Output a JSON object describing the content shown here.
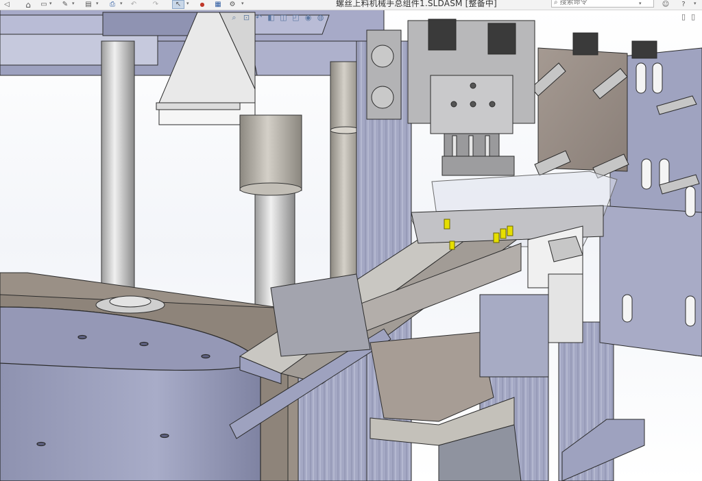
{
  "window": {
    "title": "螺丝上料机械手总组件1.SLDASM [整备中]"
  },
  "search": {
    "placeholder": "搜索命令"
  },
  "toolbar": {
    "items": [
      {
        "name": "solidworks-logo-icon",
        "glyph": "◁"
      },
      {
        "name": "home-icon",
        "glyph": "⌂"
      },
      {
        "name": "new-document-icon",
        "glyph": "▭"
      },
      {
        "name": "open-document-icon",
        "glyph": "✎"
      },
      {
        "name": "save-icon",
        "glyph": "▤"
      },
      {
        "name": "print-icon",
        "glyph": "⎙"
      },
      {
        "name": "undo-icon",
        "glyph": "↶"
      },
      {
        "name": "redo-icon",
        "glyph": "↷"
      },
      {
        "name": "select-icon",
        "glyph": "↖"
      },
      {
        "name": "traffic-light-icon",
        "glyph": "●"
      },
      {
        "name": "file-properties-icon",
        "glyph": "▦"
      },
      {
        "name": "options-gear-icon",
        "glyph": "⚙"
      }
    ]
  },
  "view_toolbar": {
    "items": [
      {
        "name": "zoom-to-fit-icon",
        "glyph": "⌕"
      },
      {
        "name": "zoom-area-icon",
        "glyph": "⊡"
      },
      {
        "name": "previous-view-icon",
        "glyph": "↶"
      },
      {
        "name": "section-view-icon",
        "glyph": "◧"
      },
      {
        "name": "view-orientation-icon",
        "glyph": "◫"
      },
      {
        "name": "display-style-icon",
        "glyph": "◰"
      },
      {
        "name": "hide-show-items-icon",
        "glyph": "◉"
      },
      {
        "name": "appearance-icon",
        "glyph": "◍"
      }
    ]
  },
  "right_tools": {
    "items": [
      {
        "name": "user-icon",
        "glyph": "☺"
      },
      {
        "name": "help-icon",
        "glyph": "?"
      },
      {
        "name": "collapse-icon",
        "glyph": "▯"
      }
    ]
  },
  "colors": {
    "background": "#ffffff",
    "frame_purple": "#9ea3c2",
    "frame_dark": "#7e82a3",
    "gray_part": "#b4b4b6",
    "brown_plate": "#9a8e86",
    "yellow_pin": "#e6df00"
  }
}
